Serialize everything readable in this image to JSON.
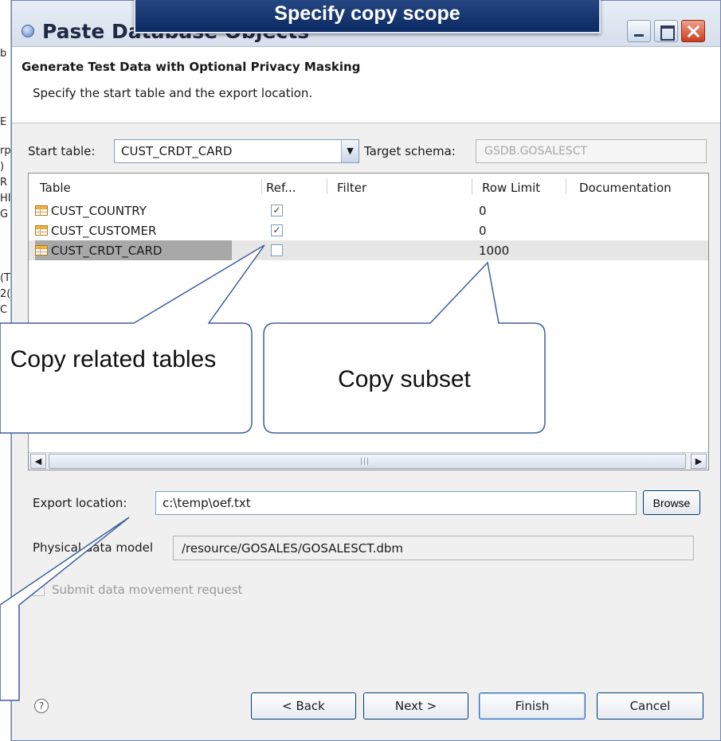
{
  "window": {
    "title": "Paste Database Objects",
    "overlay_banner": "Specify copy scope"
  },
  "header": {
    "title": "Generate Test Data with Optional Privacy Masking",
    "description": "Specify the start table and the export location."
  },
  "start_table": {
    "label": "Start table:",
    "value": "CUST_CRDT_CARD"
  },
  "target_schema": {
    "label": "Target schema:",
    "value": "GSDB.GOSALESCT"
  },
  "table": {
    "columns": [
      "Table",
      "Ref...",
      "Filter",
      "Row Limit",
      "Documentation"
    ],
    "rows": [
      {
        "name": "CUST_COUNTRY",
        "ref_checked": true,
        "filter": "",
        "row_limit": "0"
      },
      {
        "name": "CUST_CUSTOMER",
        "ref_checked": true,
        "filter": "",
        "row_limit": "0"
      },
      {
        "name": "CUST_CRDT_CARD",
        "ref_checked": false,
        "filter": "",
        "row_limit": "1000"
      }
    ]
  },
  "export": {
    "label": "Export location:",
    "value": "c:\\temp\\oef.txt",
    "browse_label": "Browse"
  },
  "physical_model": {
    "label": "Physical data model",
    "value": "/resource/GOSALES/GOSALESCT.dbm"
  },
  "submit": {
    "label": "Submit data movement request",
    "checked": false
  },
  "buttons": {
    "back": "< Back",
    "next": "Next >",
    "finish": "Finish",
    "cancel": "Cancel"
  },
  "callouts": {
    "related": "Copy related tables",
    "subset": "Copy subset"
  },
  "background_fragments": [
    "b",
    "E",
    "rp",
    ")",
    "R",
    "HI",
    "G",
    "(T",
    "2(",
    "C"
  ]
}
